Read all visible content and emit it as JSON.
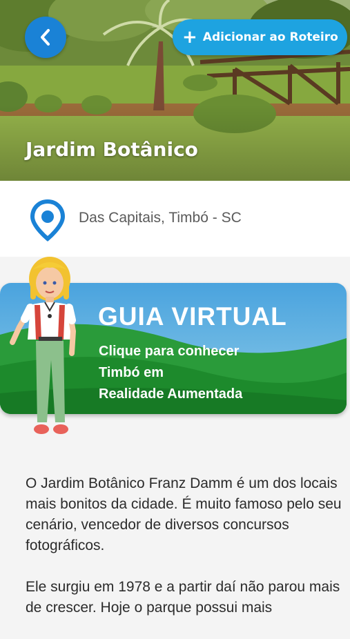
{
  "header": {
    "add_button_label": "Adicionar ao Roteiro",
    "add_button_icon": "plus-icon",
    "back_button_icon": "chevron-left-icon",
    "title": "Jardim Botânico"
  },
  "location": {
    "icon": "map-pin-icon",
    "text": "Das Capitais, Timbó - SC"
  },
  "guide_banner": {
    "title": "GUIA VIRTUAL",
    "subtitle_lines": [
      "Clique para conhecer",
      "Timbó em",
      "Realidade Aumentada"
    ]
  },
  "description": {
    "paragraphs": [
      "O Jardim Botânico Franz Damm é um dos locais mais bonitos da cidade. É muito famoso pelo seu cenário, vencedor de diversos concursos fotográficos.",
      "Ele surgiu em 1978 e a partir daí não parou mais de crescer. Hoje o parque possui mais"
    ]
  },
  "colors": {
    "primary_blue": "#1a82d6",
    "button_blue": "#1ea3e0",
    "banner_green": "#1f8f2e"
  }
}
